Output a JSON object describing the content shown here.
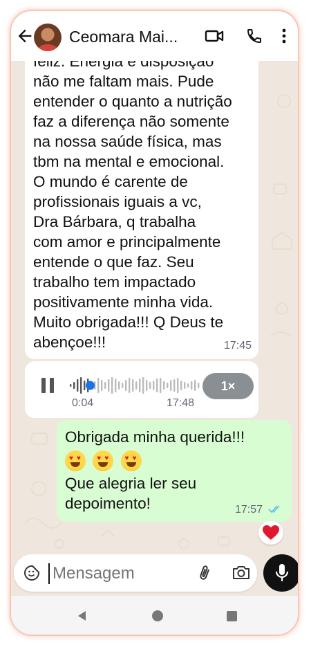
{
  "header": {
    "contact_name": "Ceomara Mai...",
    "icons": [
      "back-arrow-icon",
      "video-call-icon",
      "voice-call-icon",
      "more-vert-icon"
    ]
  },
  "messages": {
    "incoming_text": {
      "partial_top_line": "feliz. Energia e disposição",
      "lines": [
        "não me faltam mais. Pude",
        "entender o quanto a nutrição",
        "faz a diferença não somente",
        "na nossa saúde física, mas",
        "tbm na mental e emocional.",
        "O mundo é carente de",
        "profissionais iguais a vc,",
        "Dra Bárbara, q trabalha",
        "com amor e principalmente",
        "entende o que faz. Seu",
        "trabalho tem impactado",
        "positivamente minha vida.",
        "Muito obrigada!!! Q Deus te",
        "abençoe!!!"
      ],
      "time": "17:45"
    },
    "audio": {
      "elapsed": "0:04",
      "time": "17:48",
      "speed": "1×",
      "progress": 0.15
    },
    "outgoing": {
      "line1": "Obrigada minha querida!!!",
      "emoji_count": 3,
      "line3": "Que alegria ler seu",
      "line4": "depoimento!",
      "time": "17:57",
      "status": "read"
    },
    "reaction": "heart"
  },
  "composer": {
    "placeholder": "Mensagem",
    "icons": [
      "emoji-sticker-icon",
      "attach-icon",
      "camera-icon",
      "mic-icon"
    ]
  },
  "colors": {
    "wallpaper": "#efe7dd",
    "outgoing_bubble": "#d9fdd3",
    "incoming_bubble": "#ffffff",
    "read_ticks": "#53bdeb",
    "audio_dot": "#1a73e8"
  }
}
